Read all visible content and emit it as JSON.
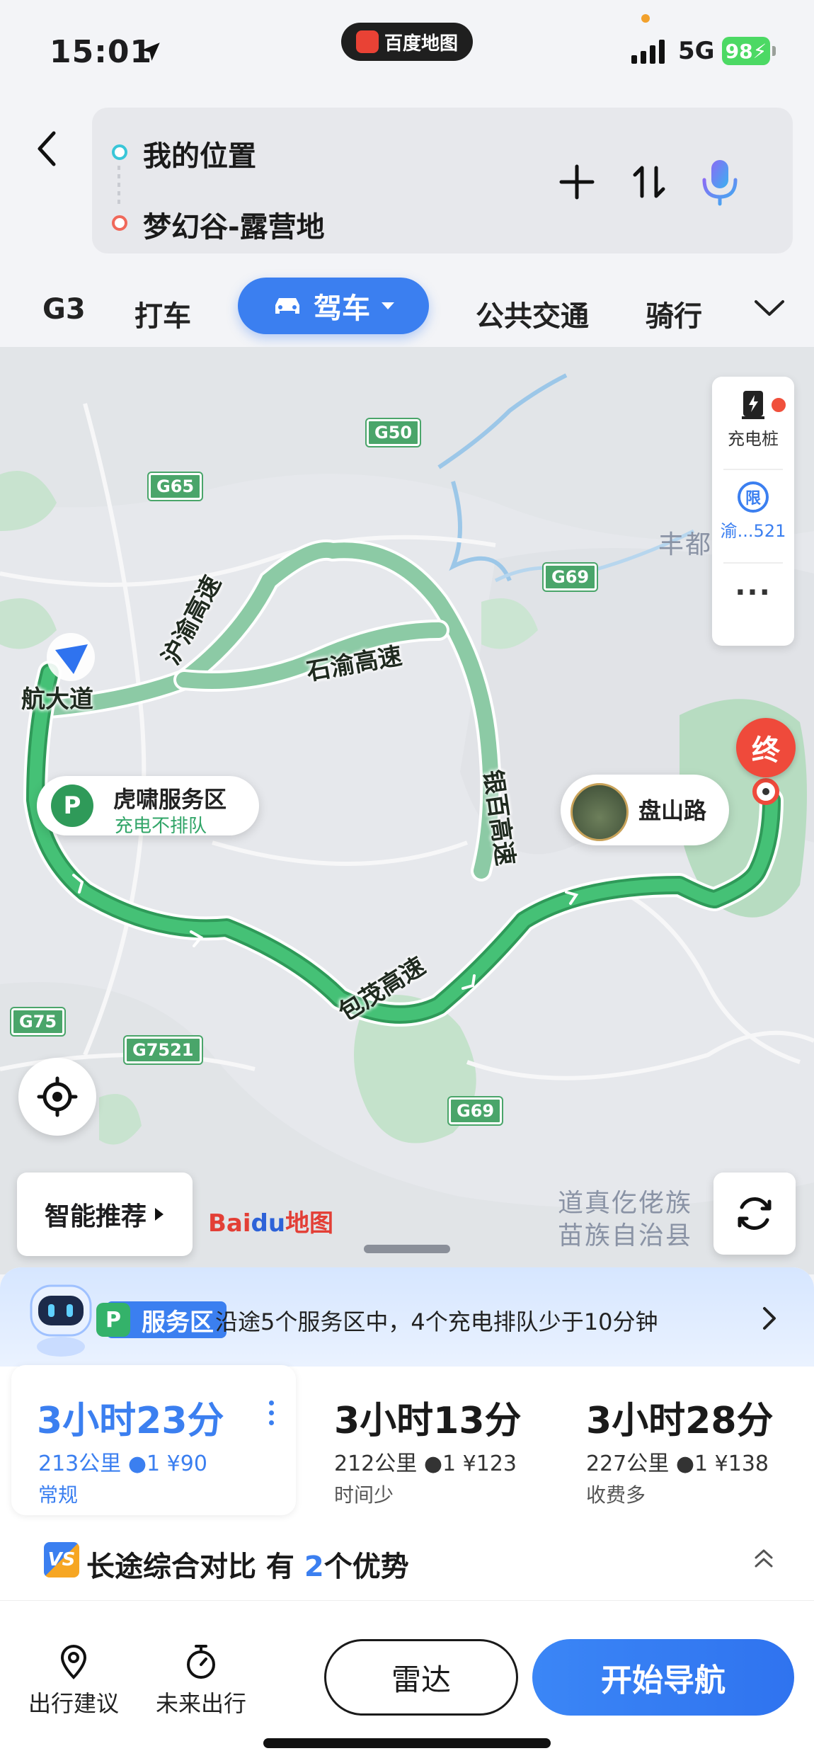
{
  "status": {
    "time": "15:01",
    "app_name": "百度地图",
    "network": "5G",
    "battery": "98"
  },
  "route": {
    "from": "我的位置",
    "to": "梦幻谷-露营地"
  },
  "modes": {
    "g3": "G3",
    "taxi": "打车",
    "drive": "驾车",
    "transit": "公共交通",
    "bike": "骑行"
  },
  "map": {
    "roads": [
      "沪渝高速",
      "石渝高速",
      "银百高速",
      "包茂高速",
      "航大道"
    ],
    "shields": [
      "G50",
      "G65",
      "G69",
      "G75",
      "G7521",
      "G69"
    ],
    "places": [
      "丰都",
      "道真仡佬族",
      "苗族自治县"
    ],
    "charging_label": "充电桩",
    "restriction_label": "渝...521",
    "restriction_icon": "限",
    "more": "...",
    "service_area": {
      "name": "虎啸服务区",
      "note": "充电不排队"
    },
    "poi": "盘山路",
    "end_marker": "终",
    "smart_recommend": "智能推荐",
    "logo_bai": "Bai",
    "logo_du": "du",
    "logo_map": "地图"
  },
  "service_bar": {
    "tag": "服务区",
    "text": "沿途5个服务区中，4个充电排队少于10分钟"
  },
  "options": [
    {
      "duration": "3小时23分",
      "distance": "213公里",
      "lights": "1",
      "toll": "¥90",
      "tag": "常规"
    },
    {
      "duration": "3小时13分",
      "distance": "212公里",
      "lights": "1",
      "toll": "¥123",
      "tag": "时间少"
    },
    {
      "duration": "3小时28分",
      "distance": "227公里",
      "lights": "1",
      "toll": "¥138",
      "tag": "收费多"
    }
  ],
  "compare": {
    "vs": "VS",
    "prefix": "长途综合对比 有",
    "count": "2",
    "suffix": "个优势"
  },
  "actions": {
    "advice": "出行建议",
    "future": "未来出行",
    "radar": "雷达",
    "start": "开始导航"
  },
  "colors": {
    "accent": "#3b7ff0",
    "route_main": "#3fba6a",
    "route_alt": "#7dc7a0",
    "end": "#ef4a3b"
  }
}
